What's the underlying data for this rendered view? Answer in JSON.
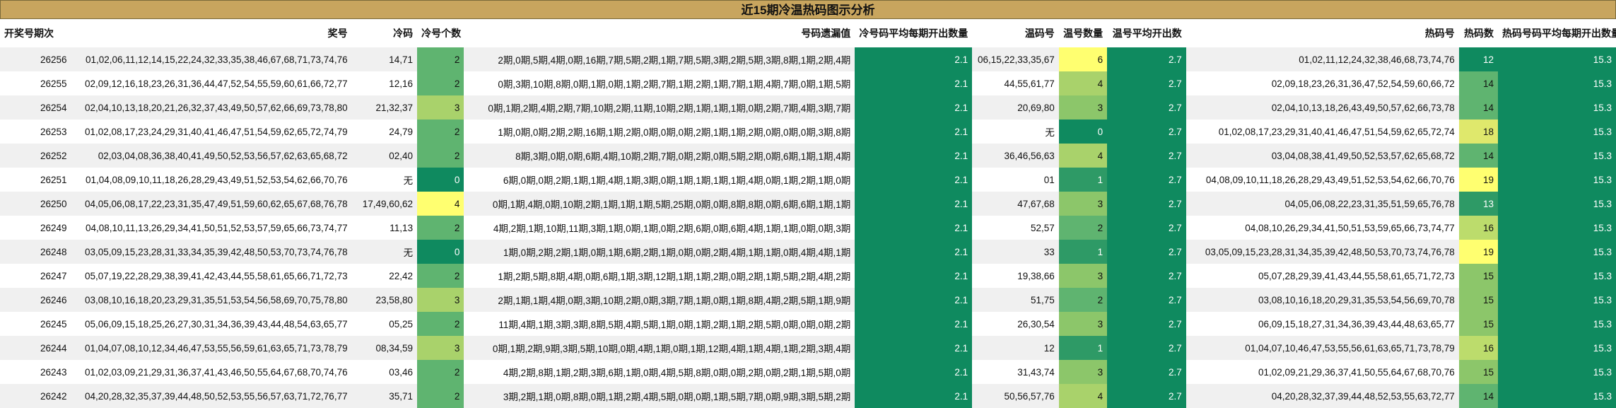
{
  "title": "近15期冷温热码图示分析",
  "headers": [
    "开奖号期次",
    "奖号",
    "冷码",
    "冷号个数",
    "号码遗漏值",
    "冷号码平均每期开出数量",
    "温码号",
    "温号数量",
    "温号平均开出数",
    "热码号",
    "热码数",
    "热码号码平均每期开出数量"
  ],
  "colors": {
    "dark_green": "#0f8a5f",
    "mid_green": "#2e9a66",
    "green_4": "#a9d26b",
    "green_3": "#8cc66a",
    "green_2": "#5fb470",
    "yellow": "#ffff70",
    "green_14": "#5fb470",
    "green_15": "#8cc66a",
    "green_16": "#bcdc6c",
    "green_13": "#2e9a66",
    "green_12": "#0f8a5f",
    "green_18": "#dfe86c"
  },
  "rows": [
    {
      "issue": "26256",
      "nums": "01,02,06,11,12,14,15,22,24,32,33,35,38,46,67,68,71,73,74,76",
      "cold": "14,71",
      "cold_n": "2",
      "miss": "2期,0期,5期,4期,0期,16期,7期,5期,2期,1期,7期,5期,3期,2期,5期,3期,8期,1期,2期,4期",
      "cold_avg": "2.1",
      "warm": "06,15,22,33,35,67",
      "warm_n": "6",
      "warm_avg": "2.7",
      "hot": "01,02,11,12,24,32,38,46,68,73,74,76",
      "hot_n": "12",
      "hot_avg": "15.3"
    },
    {
      "issue": "26255",
      "nums": "02,09,12,16,18,23,26,31,36,44,47,52,54,55,59,60,61,66,72,77",
      "cold": "12,16",
      "cold_n": "2",
      "miss": "0期,3期,10期,8期,0期,1期,0期,1期,2期,7期,1期,2期,1期,7期,1期,4期,7期,0期,1期,5期",
      "cold_avg": "2.1",
      "warm": "44,55,61,77",
      "warm_n": "4",
      "warm_avg": "2.7",
      "hot": "02,09,18,23,26,31,36,47,52,54,59,60,66,72",
      "hot_n": "14",
      "hot_avg": "15.3"
    },
    {
      "issue": "26254",
      "nums": "02,04,10,13,18,20,21,26,32,37,43,49,50,57,62,66,69,73,78,80",
      "cold": "21,32,37",
      "cold_n": "3",
      "miss": "0期,1期,2期,4期,2期,7期,10期,2期,11期,10期,2期,1期,1期,1期,0期,2期,7期,4期,3期,7期",
      "cold_avg": "2.1",
      "warm": "20,69,80",
      "warm_n": "3",
      "warm_avg": "2.7",
      "hot": "02,04,10,13,18,26,43,49,50,57,62,66,73,78",
      "hot_n": "14",
      "hot_avg": "15.3"
    },
    {
      "issue": "26253",
      "nums": "01,02,08,17,23,24,29,31,40,41,46,47,51,54,59,62,65,72,74,79",
      "cold": "24,79",
      "cold_n": "2",
      "miss": "1期,0期,0期,2期,2期,16期,1期,2期,0期,0期,0期,2期,1期,1期,2期,0期,0期,0期,3期,8期",
      "cold_avg": "2.1",
      "warm": "无",
      "warm_n": "0",
      "warm_avg": "2.7",
      "hot": "01,02,08,17,23,29,31,40,41,46,47,51,54,59,62,65,72,74",
      "hot_n": "18",
      "hot_avg": "15.3"
    },
    {
      "issue": "26252",
      "nums": "02,03,04,08,36,38,40,41,49,50,52,53,56,57,62,63,65,68,72",
      "cold": "02,40",
      "cold_n": "2",
      "miss": "8期,3期,0期,0期,6期,4期,10期,2期,7期,0期,2期,0期,5期,2期,0期,6期,1期,1期,4期",
      "cold_avg": "2.1",
      "warm": "36,46,56,63",
      "warm_n": "4",
      "warm_avg": "2.7",
      "hot": "03,04,08,38,41,49,50,52,53,57,62,65,68,72",
      "hot_n": "14",
      "hot_avg": "15.3"
    },
    {
      "issue": "26251",
      "nums": "01,04,08,09,10,11,18,26,28,29,43,49,51,52,53,54,62,66,70,76",
      "cold": "无",
      "cold_n": "0",
      "miss": "6期,0期,0期,2期,1期,1期,4期,1期,3期,0期,1期,1期,1期,1期,4期,0期,1期,2期,1期,0期",
      "cold_avg": "2.1",
      "warm": "01",
      "warm_n": "1",
      "warm_avg": "2.7",
      "hot": "04,08,09,10,11,18,26,28,29,43,49,51,52,53,54,62,66,70,76",
      "hot_n": "19",
      "hot_avg": "15.3"
    },
    {
      "issue": "26250",
      "nums": "04,05,06,08,17,22,23,31,35,47,49,51,59,60,62,65,67,68,76,78",
      "cold": "17,49,60,62",
      "cold_n": "4",
      "miss": "0期,1期,4期,0期,10期,2期,1期,1期,1期,5期,25期,0期,0期,8期,8期,0期,6期,6期,1期,1期",
      "cold_avg": "2.1",
      "warm": "47,67,68",
      "warm_n": "3",
      "warm_avg": "2.7",
      "hot": "04,05,06,08,22,23,31,35,51,59,65,76,78",
      "hot_n": "13",
      "hot_avg": "15.3"
    },
    {
      "issue": "26249",
      "nums": "04,08,10,11,13,26,29,34,41,50,51,52,53,57,59,65,66,73,74,77",
      "cold": "11,13",
      "cold_n": "2",
      "miss": "4期,2期,1期,10期,11期,3期,1期,0期,1期,0期,2期,6期,0期,6期,4期,1期,1期,0期,0期,3期",
      "cold_avg": "2.1",
      "warm": "52,57",
      "warm_n": "2",
      "warm_avg": "2.7",
      "hot": "04,08,10,26,29,34,41,50,51,53,59,65,66,73,74,77",
      "hot_n": "16",
      "hot_avg": "15.3"
    },
    {
      "issue": "26248",
      "nums": "03,05,09,15,23,28,31,33,34,35,39,42,48,50,53,70,73,74,76,78",
      "cold": "无",
      "cold_n": "0",
      "miss": "1期,0期,2期,2期,1期,0期,1期,6期,2期,1期,0期,0期,2期,4期,1期,1期,0期,4期,4期,1期",
      "cold_avg": "2.1",
      "warm": "33",
      "warm_n": "1",
      "warm_avg": "2.7",
      "hot": "03,05,09,15,23,28,31,34,35,39,42,48,50,53,70,73,74,76,78",
      "hot_n": "19",
      "hot_avg": "15.3"
    },
    {
      "issue": "26247",
      "nums": "05,07,19,22,28,29,38,39,41,42,43,44,55,58,61,65,66,71,72,73",
      "cold": "22,42",
      "cold_n": "2",
      "miss": "1期,2期,5期,8期,4期,0期,6期,1期,3期,12期,1期,1期,2期,0期,2期,1期,5期,2期,4期,2期",
      "cold_avg": "2.1",
      "warm": "19,38,66",
      "warm_n": "3",
      "warm_avg": "2.7",
      "hot": "05,07,28,29,39,41,43,44,55,58,61,65,71,72,73",
      "hot_n": "15",
      "hot_avg": "15.3"
    },
    {
      "issue": "26246",
      "nums": "03,08,10,16,18,20,23,29,31,35,51,53,54,56,58,69,70,75,78,80",
      "cold": "23,58,80",
      "cold_n": "3",
      "miss": "2期,1期,1期,4期,0期,3期,10期,2期,0期,3期,7期,1期,0期,1期,8期,4期,2期,5期,1期,9期",
      "cold_avg": "2.1",
      "warm": "51,75",
      "warm_n": "2",
      "warm_avg": "2.7",
      "hot": "03,08,10,16,18,20,29,31,35,53,54,56,69,70,78",
      "hot_n": "15",
      "hot_avg": "15.3"
    },
    {
      "issue": "26245",
      "nums": "05,06,09,15,18,25,26,27,30,31,34,36,39,43,44,48,54,63,65,77",
      "cold": "05,25",
      "cold_n": "2",
      "miss": "11期,4期,1期,3期,3期,8期,5期,4期,5期,1期,0期,1期,2期,1期,2期,5期,0期,0期,0期,2期",
      "cold_avg": "2.1",
      "warm": "26,30,54",
      "warm_n": "3",
      "warm_avg": "2.7",
      "hot": "06,09,15,18,27,31,34,36,39,43,44,48,63,65,77",
      "hot_n": "15",
      "hot_avg": "15.3"
    },
    {
      "issue": "26244",
      "nums": "01,04,07,08,10,12,34,46,47,53,55,56,59,61,63,65,71,73,78,79",
      "cold": "08,34,59",
      "cold_n": "3",
      "miss": "0期,1期,2期,9期,3期,5期,10期,0期,4期,1期,0期,1期,12期,4期,1期,4期,1期,2期,3期,4期",
      "cold_avg": "2.1",
      "warm": "12",
      "warm_n": "1",
      "warm_avg": "2.7",
      "hot": "01,04,07,10,46,47,53,55,56,61,63,65,71,73,78,79",
      "hot_n": "16",
      "hot_avg": "15.3"
    },
    {
      "issue": "26243",
      "nums": "01,02,03,09,21,29,31,36,37,41,43,46,50,55,64,67,68,70,74,76",
      "cold": "03,46",
      "cold_n": "2",
      "miss": "4期,2期,8期,1期,2期,3期,6期,1期,0期,4期,5期,8期,0期,0期,2期,0期,2期,1期,5期,0期",
      "cold_avg": "2.1",
      "warm": "31,43,74",
      "warm_n": "3",
      "warm_avg": "2.7",
      "hot": "01,02,09,21,29,36,37,41,50,55,64,67,68,70,76",
      "hot_n": "15",
      "hot_avg": "15.3"
    },
    {
      "issue": "26242",
      "nums": "04,20,28,32,35,37,39,44,48,50,52,53,55,56,57,63,71,72,76,77",
      "cold": "35,71",
      "cold_n": "2",
      "miss": "3期,2期,1期,0期,8期,0期,1期,2期,4期,5期,0期,0期,1期,5期,7期,0期,9期,3期,5期,2期",
      "cold_avg": "2.1",
      "warm": "50,56,57,76",
      "warm_n": "4",
      "warm_avg": "2.7",
      "hot": "04,20,28,32,37,39,44,48,52,53,55,63,72,77",
      "hot_n": "14",
      "hot_avg": "15.3"
    }
  ]
}
